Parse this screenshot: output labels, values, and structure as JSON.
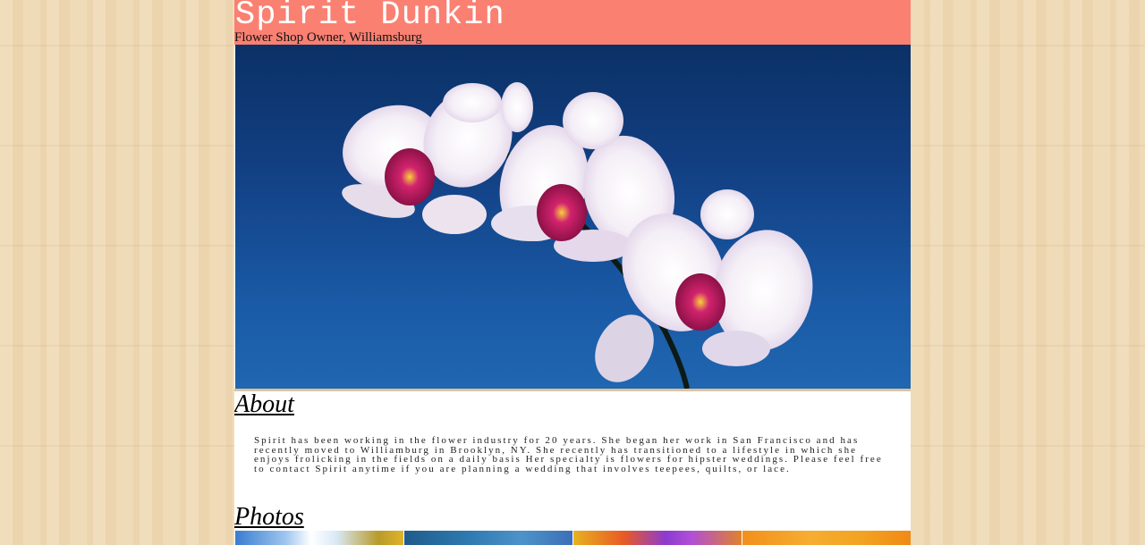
{
  "header": {
    "title": "Spirit Dunkin",
    "subtitle": "Flower Shop Owner, Williamsburg"
  },
  "hero": {
    "image": "white-pink-orchid-on-blue-sky"
  },
  "about": {
    "heading": "About",
    "text": "Spirit has been working in the flower industry for 20 years. She began her work in San Francisco and has recently moved to Williamburg in Brooklyn, NY. She recently has transitioned to a lifestyle in which she enjoys frolicking in the fields on a daily basis Her specialty is flowers for hipster weddings. Please feel free to contact Spirit anytime if you are planning a wedding that involves teepees, quilts, or lace."
  },
  "photos": {
    "heading": "Photos",
    "thumbnails": [
      "sunflower-sky-photo",
      "blue-water-photo",
      "colorful-flowers-photo",
      "orange-sunset-photo"
    ]
  },
  "colors": {
    "header_bg": "#fa8072",
    "title_text": "#ffffff",
    "page_bg": "#efd9b4",
    "sky_blue": "#1a5aa6"
  }
}
